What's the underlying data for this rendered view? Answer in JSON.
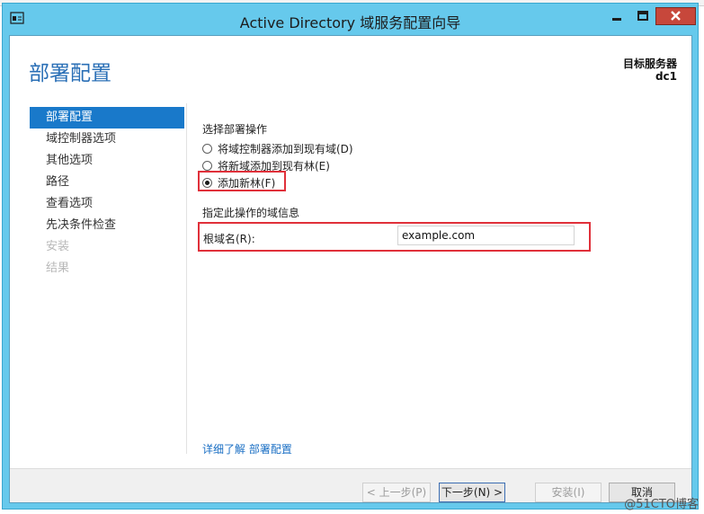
{
  "window": {
    "title": "Active Directory 域服务配置向导",
    "controls": {
      "minimize_icon": "minimize-icon",
      "maximize_icon": "maximize-icon",
      "close_icon": "close-icon"
    }
  },
  "header": {
    "page_title": "部署配置",
    "target_label": "目标服务器",
    "target_name": "dc1"
  },
  "nav": {
    "items": [
      {
        "label": "部署配置",
        "state": "active"
      },
      {
        "label": "域控制器选项",
        "state": "normal"
      },
      {
        "label": "其他选项",
        "state": "normal"
      },
      {
        "label": "路径",
        "state": "normal"
      },
      {
        "label": "查看选项",
        "state": "normal"
      },
      {
        "label": "先决条件检查",
        "state": "normal"
      },
      {
        "label": "安装",
        "state": "disabled"
      },
      {
        "label": "结果",
        "state": "disabled"
      }
    ]
  },
  "main": {
    "deploy_section_title": "选择部署操作",
    "options": [
      {
        "label": "将域控制器添加到现有域(D)",
        "checked": false
      },
      {
        "label": "将新域添加到现有林(E)",
        "checked": false
      },
      {
        "label": "添加新林(F)",
        "checked": true
      }
    ],
    "domain_section_title": "指定此操作的域信息",
    "root_domain_label": "根域名(R):",
    "root_domain_value": "example.com",
    "more_link": "详细了解 部署配置"
  },
  "footer": {
    "prev_label": "< 上一步(P)",
    "next_label": "下一步(N) >",
    "install_label": "安装(I)",
    "cancel_label": "取消"
  },
  "watermark": "@51CTO博客",
  "colors": {
    "accent": "#1979ca",
    "title_bar": "#66c9ec",
    "highlight": "#e0303a",
    "close": "#c7473b"
  }
}
